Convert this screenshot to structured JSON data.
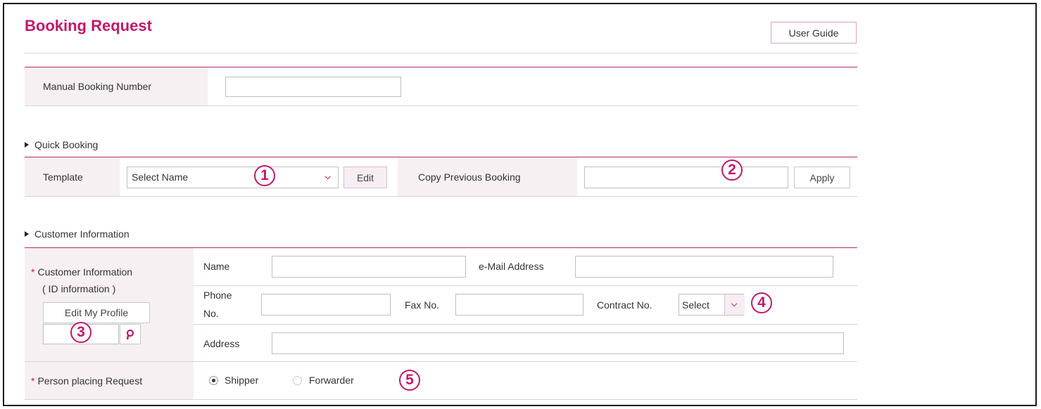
{
  "page": {
    "title": "Booking Request",
    "user_guide_label": "User Guide"
  },
  "manual_booking": {
    "label": "Manual Booking Number",
    "value": ""
  },
  "quick_booking": {
    "section_title": "Quick Booking",
    "template_label": "Template",
    "template_selected": "Select Name",
    "edit_label": "Edit",
    "copy_label": "Copy Previous Booking",
    "copy_value": "",
    "apply_label": "Apply"
  },
  "customer": {
    "section_title": "Customer Information",
    "label_line1": "Customer Information",
    "label_line2": "( ID information )",
    "edit_profile_label": "Edit My Profile",
    "id_value": "",
    "name_label": "Name",
    "name_value": "",
    "email_label": "e-Mail Address",
    "email_value": "",
    "phone_label_1": "Phone",
    "phone_label_2": "No.",
    "phone_value": "",
    "fax_label": "Fax No.",
    "fax_value": "",
    "contract_label": "Contract No.",
    "contract_selected": "Select",
    "address_label": "Address",
    "address_value": ""
  },
  "person": {
    "label": "Person placing Request",
    "options": [
      {
        "label": "Shipper",
        "selected": true
      },
      {
        "label": "Forwarder",
        "selected": false
      }
    ]
  },
  "markers": [
    "1",
    "2",
    "3",
    "4",
    "5"
  ],
  "colors": {
    "accent": "#c0196b",
    "label_bg": "#f6f0f3"
  }
}
